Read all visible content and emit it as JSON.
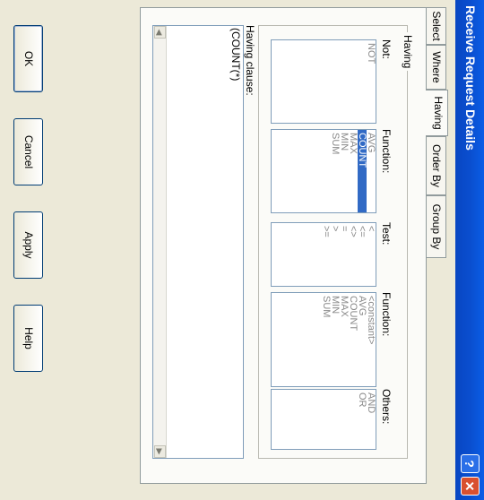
{
  "window": {
    "title": "Receive Request Details",
    "help_glyph": "?",
    "close_glyph": "✕"
  },
  "tabs": [
    "Select",
    "Where",
    "Having",
    "Order By",
    "Group By"
  ],
  "active_tab": "Having",
  "having_group": {
    "title": "Having",
    "labels": {
      "not": "Not:",
      "function1": "Function:",
      "test": "Test:",
      "function2": "Function:",
      "others": "Others:"
    },
    "not_items": [
      "NOT"
    ],
    "function_items": [
      "AVG",
      "COUNT",
      "MAX",
      "MIN",
      "SUM"
    ],
    "function_selected": "COUNT",
    "test_items": [
      "<",
      "<=",
      "<>",
      "=",
      ">",
      ">="
    ],
    "function2_items": [
      "<constant>",
      "AVG",
      "COUNT",
      "MAX",
      "MIN",
      "SUM"
    ],
    "others_items": [
      "AND",
      "OR"
    ]
  },
  "having_clause": {
    "label": "Having clause:",
    "value": "(COUNT(*)"
  },
  "buttons": {
    "ok": "OK",
    "cancel": "Cancel",
    "apply": "Apply",
    "help": "Help"
  },
  "icons": {
    "scroll_left": "◀",
    "scroll_right": "▶"
  }
}
